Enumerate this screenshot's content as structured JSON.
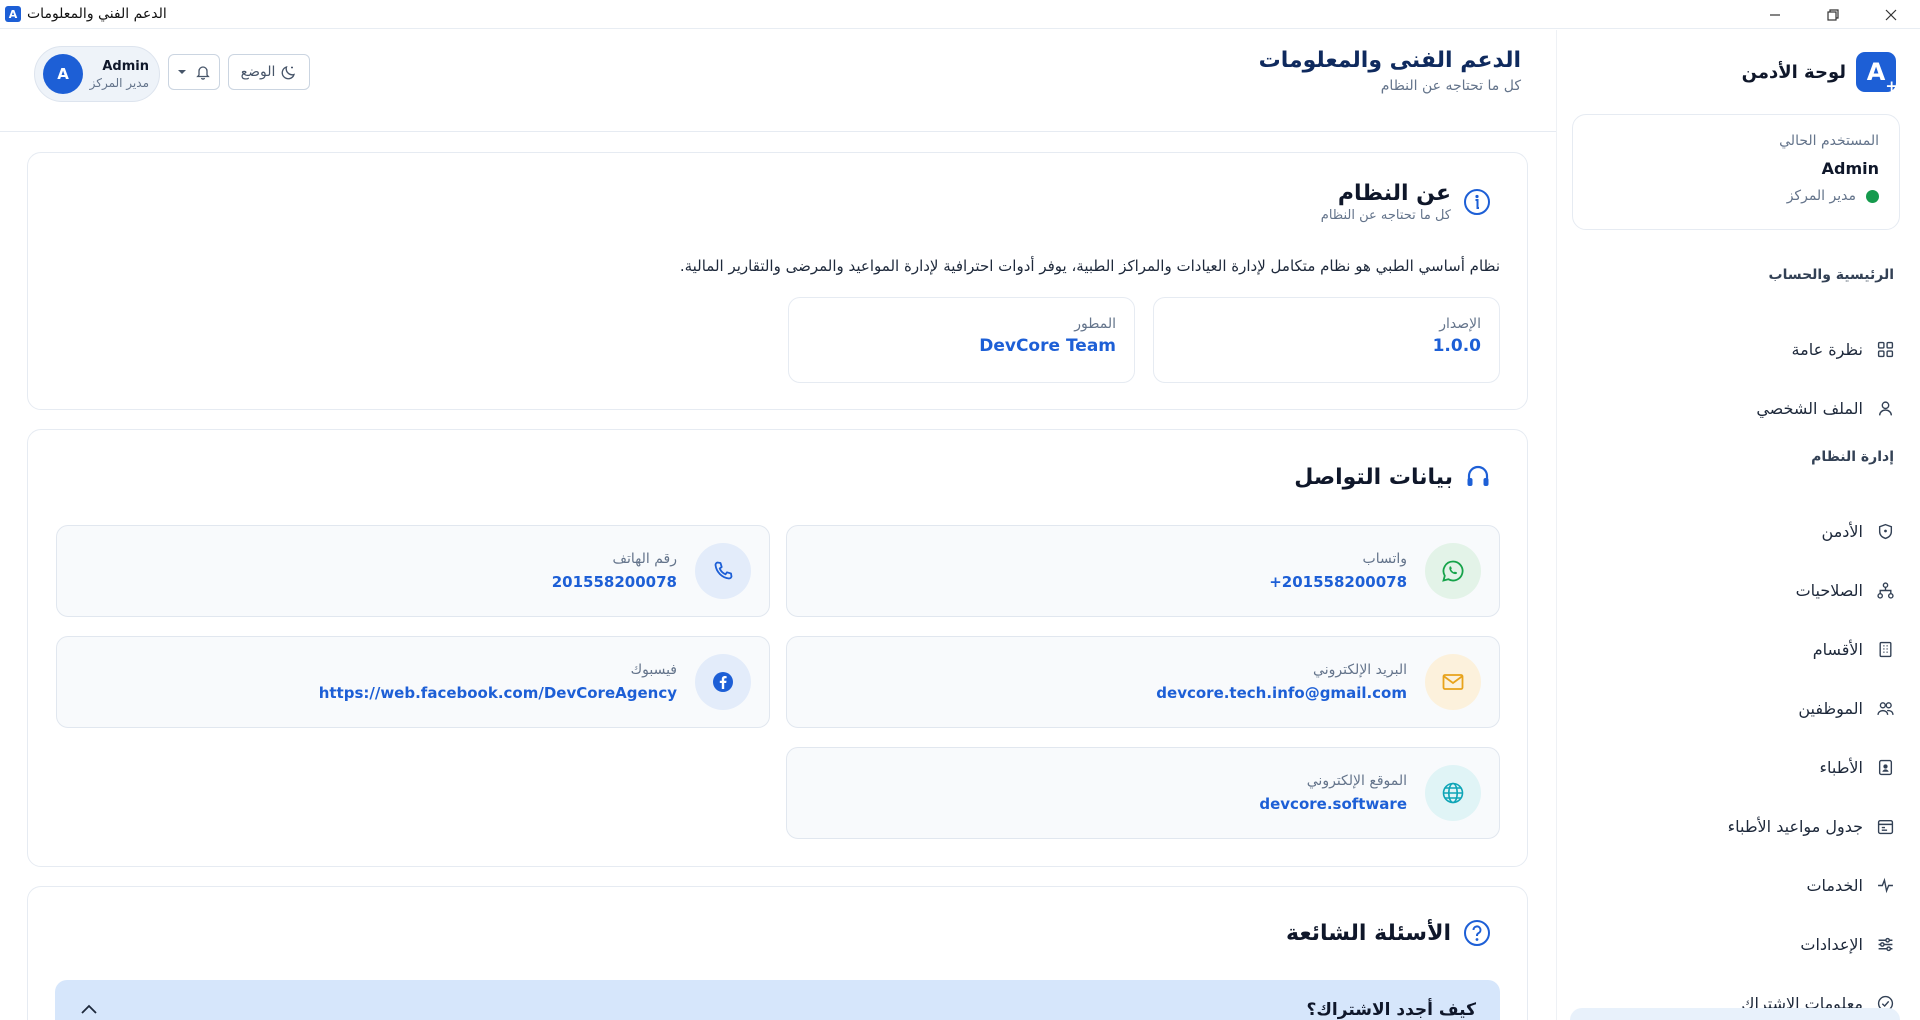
{
  "window": {
    "title": "الدعم الفني والمعلومات",
    "app_icon_letter": "A"
  },
  "sidebar": {
    "brand_title": "لوحة الأدمن",
    "brand_letter": "A",
    "user_card": {
      "label": "المستخدم الحالي",
      "name": "Admin",
      "role": "مدير المركز",
      "status_color": "#159a4d"
    },
    "sections": [
      {
        "title": "الرئيسية والحساب",
        "items": [
          {
            "label": "نظرة عامة",
            "icon": "grid-icon"
          },
          {
            "label": "الملف الشخصي",
            "icon": "user-icon"
          }
        ]
      },
      {
        "title": "إدارة النظام",
        "items": [
          {
            "label": "الأدمن",
            "icon": "shield-icon"
          },
          {
            "label": "الصلاحيات",
            "icon": "hierarchy-icon"
          },
          {
            "label": "الأقسام",
            "icon": "building-icon"
          },
          {
            "label": "الموظفين",
            "icon": "users-icon"
          },
          {
            "label": "الأطباء",
            "icon": "id-badge-icon"
          },
          {
            "label": "جدول مواعيد الأطباء",
            "icon": "calendar-icon"
          },
          {
            "label": "الخدمات",
            "icon": "activity-icon"
          },
          {
            "label": "الإعدادات",
            "icon": "sliders-icon"
          },
          {
            "label": "معلومات الاشتراك",
            "icon": "check-circle-icon"
          }
        ]
      }
    ]
  },
  "header": {
    "title": "الدعم الفنى والمعلومات",
    "subtitle": "كل ما تحتاجه عن النظام",
    "mode_label": "الوضع",
    "profile": {
      "initial": "A",
      "name": "Admin",
      "role": "مدير المركز"
    }
  },
  "about": {
    "title": "عن النظام",
    "subtitle": "كل ما تحتاجه عن النظام",
    "description": "نظام أساسي الطبي هو نظام متكامل لإدارة العيادات والمراكز الطبية، يوفر أدوات احترافية لإدارة المواعيد والمرضى والتقارير المالية.",
    "version_label": "الإصدار",
    "version_value": "1.0.0",
    "developer_label": "المطور",
    "developer_value": "DevCore Team"
  },
  "contact": {
    "title": "بيانات التواصل",
    "items": [
      {
        "key": "whatsapp",
        "label": "واتساب",
        "value": "+201558200078",
        "icon": "whatsapp-icon",
        "accent": "#16a34a",
        "bg": "#e3f3e8"
      },
      {
        "key": "phone",
        "label": "رقم الهاتف",
        "value": "201558200078",
        "icon": "phone-icon",
        "accent": "#1d5fd6",
        "bg": "#e3ecfa"
      },
      {
        "key": "email",
        "label": "البريد الإلكتروني",
        "value": "devcore.tech.info@gmail.com",
        "icon": "mail-icon",
        "accent": "#e8a31b",
        "bg": "#fcf1dc"
      },
      {
        "key": "facebook",
        "label": "فيسبوك",
        "value": "https://web.facebook.com/DevCoreAgency",
        "icon": "facebook-icon",
        "accent": "#1d5fd6",
        "bg": "#e3ecfa"
      },
      {
        "key": "website",
        "label": "الموقع الإلكتروني",
        "value": "devcore.software",
        "icon": "globe-icon",
        "accent": "#0ea5b7",
        "bg": "#e0f4f6"
      }
    ]
  },
  "faq": {
    "title": "الأسئلة الشائعة",
    "items": [
      {
        "question": "كيف أجدد الاشتراك؟",
        "expanded": true
      }
    ]
  }
}
